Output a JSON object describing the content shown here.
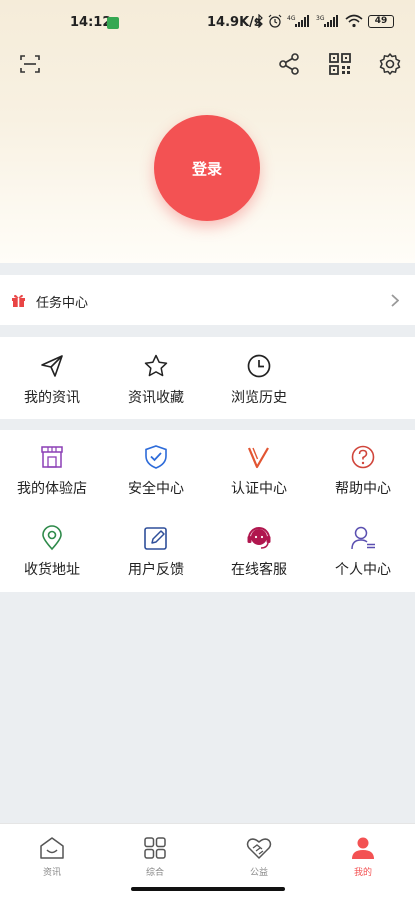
{
  "status": {
    "time": "14:12",
    "speed": "14.9K/s",
    "battery": "49",
    "net1": "4G",
    "net2": "3G"
  },
  "header": {
    "login_label": "登录"
  },
  "task": {
    "label": "任务中心"
  },
  "section1": {
    "items": [
      {
        "label": "我的资讯",
        "icon": "paper-plane-icon"
      },
      {
        "label": "资讯收藏",
        "icon": "star-icon"
      },
      {
        "label": "浏览历史",
        "icon": "clock-icon"
      }
    ]
  },
  "section2": {
    "items": [
      {
        "label": "我的体验店",
        "icon": "store-icon"
      },
      {
        "label": "安全中心",
        "icon": "shield-icon"
      },
      {
        "label": "认证中心",
        "icon": "v-badge-icon"
      },
      {
        "label": "帮助中心",
        "icon": "help-icon"
      },
      {
        "label": "收货地址",
        "icon": "location-pin-icon"
      },
      {
        "label": "用户反馈",
        "icon": "edit-icon"
      },
      {
        "label": "在线客服",
        "icon": "headset-icon"
      },
      {
        "label": "个人中心",
        "icon": "person-icon"
      }
    ]
  },
  "nav": {
    "items": [
      {
        "label": "资讯",
        "icon": "home-icon"
      },
      {
        "label": "综合",
        "icon": "grid-icon"
      },
      {
        "label": "公益",
        "icon": "handshake-heart-icon"
      },
      {
        "label": "我的",
        "icon": "user-filled-icon"
      }
    ]
  },
  "colors": {
    "accent": "#f35253",
    "store": "#8b3fb5",
    "shield": "#2d6bd9",
    "vbadge": "#e25532",
    "help": "#d0453b",
    "pin": "#2e8a4a",
    "edit": "#2f4f9a",
    "headset": "#b0164e",
    "person": "#5a4fb0"
  }
}
